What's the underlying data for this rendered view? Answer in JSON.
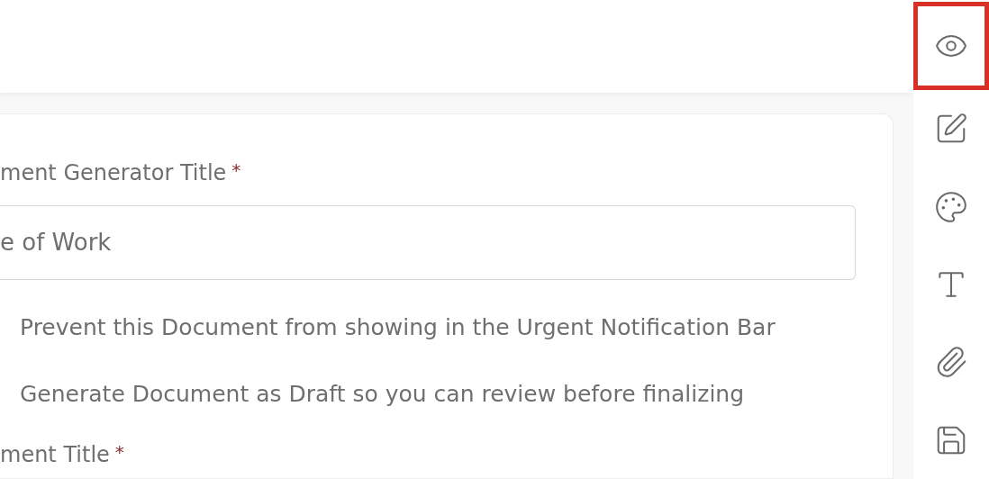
{
  "form": {
    "items": [
      {
        "kind": "label",
        "text": "ment Generator Title",
        "mark": "*"
      },
      {
        "kind": "input",
        "value": "e of Work"
      },
      {
        "kind": "option",
        "text": "Prevent this Document from showing in the Urgent Notification Bar"
      },
      {
        "kind": "option",
        "text": "Generate Document as Draft so you can review before finalizing"
      },
      {
        "kind": "label",
        "text": "ment Title",
        "mark": "*"
      }
    ]
  },
  "toolbar": [
    {
      "selected": true
    },
    {
      "selected": false
    },
    {
      "selected": false
    },
    {
      "selected": false
    },
    {
      "selected": false
    },
    {
      "selected": false
    }
  ]
}
